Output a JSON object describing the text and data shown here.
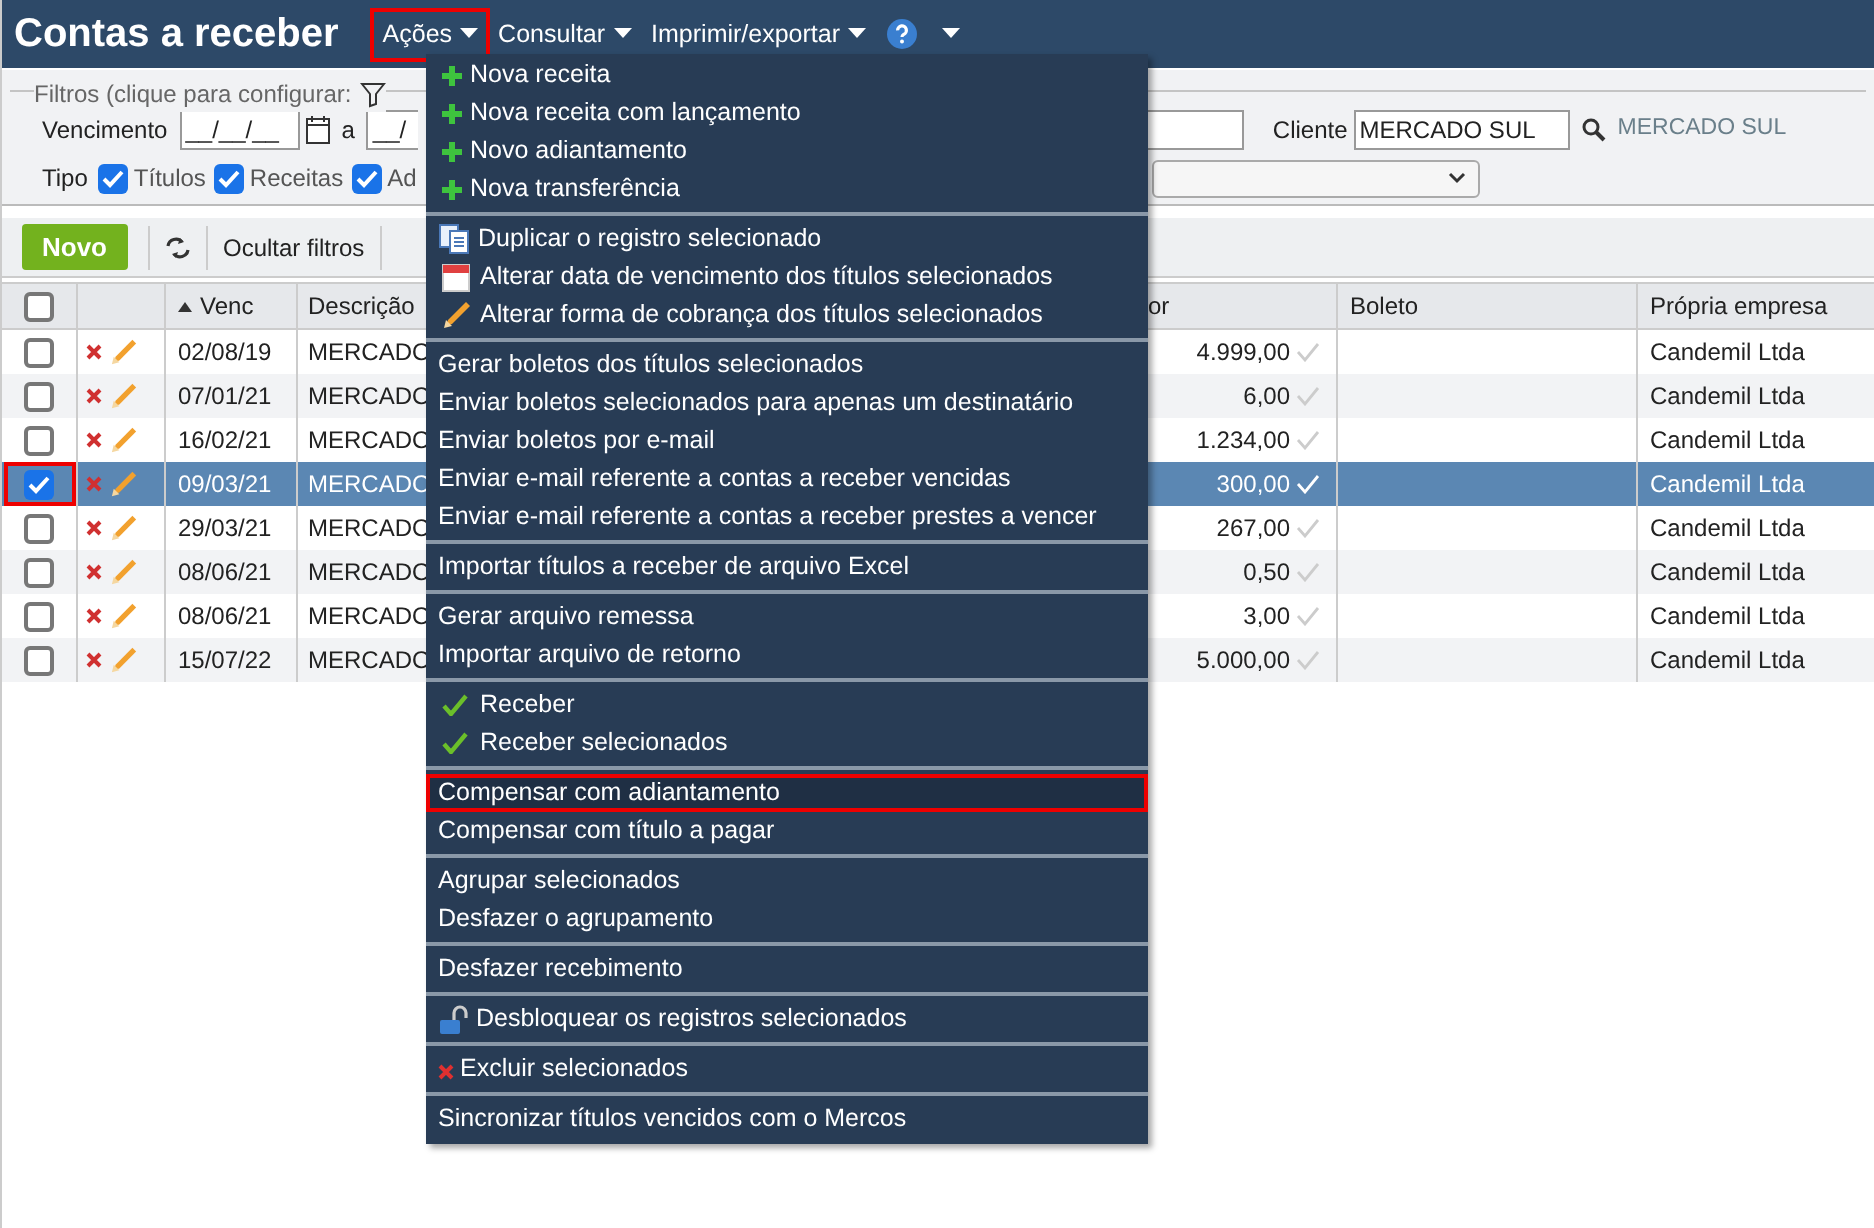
{
  "header": {
    "title": "Contas a receber",
    "menus": [
      {
        "label": "Ações",
        "callout": true
      },
      {
        "label": "Consultar",
        "callout": false
      },
      {
        "label": "Imprimir/exportar",
        "callout": false
      }
    ]
  },
  "filters": {
    "legend": "Filtros (clique para configurar:",
    "vencimento_label": "Vencimento",
    "date_from": "__/__/__",
    "between": "a",
    "date_to": "__/",
    "cliente_label": "Cliente",
    "cliente_value": "MERCADO SUL",
    "cliente_link": "MERCADO SUL",
    "tipo_label": "Tipo",
    "tipos": [
      {
        "label": "Títulos",
        "checked": true
      },
      {
        "label": "Receitas",
        "checked": true
      },
      {
        "label": "Ad",
        "checked": true
      }
    ]
  },
  "toolbar": {
    "new_button": "Novo",
    "hide_filters": "Ocultar filtros"
  },
  "table": {
    "select_all_checked": false,
    "columns": [
      "Venc",
      "Descrição",
      "or",
      "Boleto",
      "Própria empresa"
    ],
    "rows": [
      {
        "checked": false,
        "selected": false,
        "callout": false,
        "venc": "02/08/19",
        "descricao": "MERCADO",
        "valor": "4.999,00",
        "boleto": "",
        "empresa": "Candemil Ltda"
      },
      {
        "checked": false,
        "selected": false,
        "callout": false,
        "venc": "07/01/21",
        "descricao": "MERCADO",
        "valor": "6,00",
        "boleto": "",
        "empresa": "Candemil Ltda"
      },
      {
        "checked": false,
        "selected": false,
        "callout": false,
        "venc": "16/02/21",
        "descricao": "MERCADO",
        "valor": "1.234,00",
        "boleto": "",
        "empresa": "Candemil Ltda"
      },
      {
        "checked": true,
        "selected": true,
        "callout": true,
        "venc": "09/03/21",
        "descricao": "MERCADO",
        "valor": "300,00",
        "boleto": "",
        "empresa": "Candemil Ltda"
      },
      {
        "checked": false,
        "selected": false,
        "callout": false,
        "venc": "29/03/21",
        "descricao": "MERCADO",
        "valor": "267,00",
        "boleto": "",
        "empresa": "Candemil Ltda"
      },
      {
        "checked": false,
        "selected": false,
        "callout": false,
        "venc": "08/06/21",
        "descricao": "MERCADO",
        "valor": "0,50",
        "boleto": "",
        "empresa": "Candemil Ltda"
      },
      {
        "checked": false,
        "selected": false,
        "callout": false,
        "venc": "08/06/21",
        "descricao": "MERCADO",
        "valor": "3,00",
        "boleto": "",
        "empresa": "Candemil Ltda"
      },
      {
        "checked": false,
        "selected": false,
        "callout": false,
        "venc": "15/07/22",
        "descricao": "MERCADO",
        "valor": "5.000,00",
        "boleto": "",
        "empresa": "Candemil Ltda"
      }
    ]
  },
  "menu": {
    "groups": [
      [
        {
          "label": "Nova receita",
          "kind": "plus",
          "selected": false
        },
        {
          "label": "Nova receita com lançamento",
          "kind": "plus",
          "selected": false
        },
        {
          "label": "Novo adiantamento",
          "kind": "plus",
          "selected": false
        },
        {
          "label": "Nova transferência",
          "kind": "plus",
          "selected": false
        }
      ],
      [
        {
          "label": "Duplicar o registro selecionado",
          "kind": "duplicate",
          "selected": false
        },
        {
          "label": "Alterar data de vencimento dos títulos selecionados",
          "kind": "calendar",
          "selected": false
        },
        {
          "label": "Alterar forma de cobrança dos títulos selecionados",
          "kind": "pencil",
          "selected": false
        }
      ],
      [
        {
          "label": "Gerar boletos dos títulos selecionados",
          "kind": "text",
          "selected": false
        },
        {
          "label": "Enviar boletos selecionados para apenas um destinatário",
          "kind": "text",
          "selected": false
        },
        {
          "label": "Enviar boletos por e-mail",
          "kind": "text",
          "selected": false
        },
        {
          "label": "Enviar e-mail referente a contas a receber vencidas",
          "kind": "text",
          "selected": false
        },
        {
          "label": "Enviar e-mail referente a contas a receber prestes a vencer",
          "kind": "text",
          "selected": false
        }
      ],
      [
        {
          "label": "Importar títulos a receber de arquivo Excel",
          "kind": "text",
          "selected": false
        }
      ],
      [
        {
          "label": "Gerar arquivo remessa",
          "kind": "text",
          "selected": false
        },
        {
          "label": "Importar arquivo de retorno",
          "kind": "text",
          "selected": false
        }
      ],
      [
        {
          "label": "Receber",
          "kind": "check",
          "selected": false
        },
        {
          "label": "Receber selecionados",
          "kind": "check",
          "selected": false
        }
      ],
      [
        {
          "label": "Compensar com adiantamento",
          "kind": "text",
          "selected": true
        },
        {
          "label": "Compensar com título a pagar",
          "kind": "text",
          "selected": false
        }
      ],
      [
        {
          "label": "Agrupar selecionados",
          "kind": "text",
          "selected": false
        },
        {
          "label": "Desfazer o agrupamento",
          "kind": "text",
          "selected": false
        }
      ],
      [
        {
          "label": "Desfazer recebimento",
          "kind": "text",
          "selected": false
        }
      ],
      [
        {
          "label": "Desbloquear os registros selecionados",
          "kind": "lock",
          "selected": false
        }
      ],
      [
        {
          "label": "Excluir selecionados",
          "kind": "delete",
          "selected": false
        }
      ],
      [
        {
          "label": "Sincronizar títulos vencidos com o Mercos",
          "kind": "text",
          "selected": false
        }
      ]
    ]
  }
}
